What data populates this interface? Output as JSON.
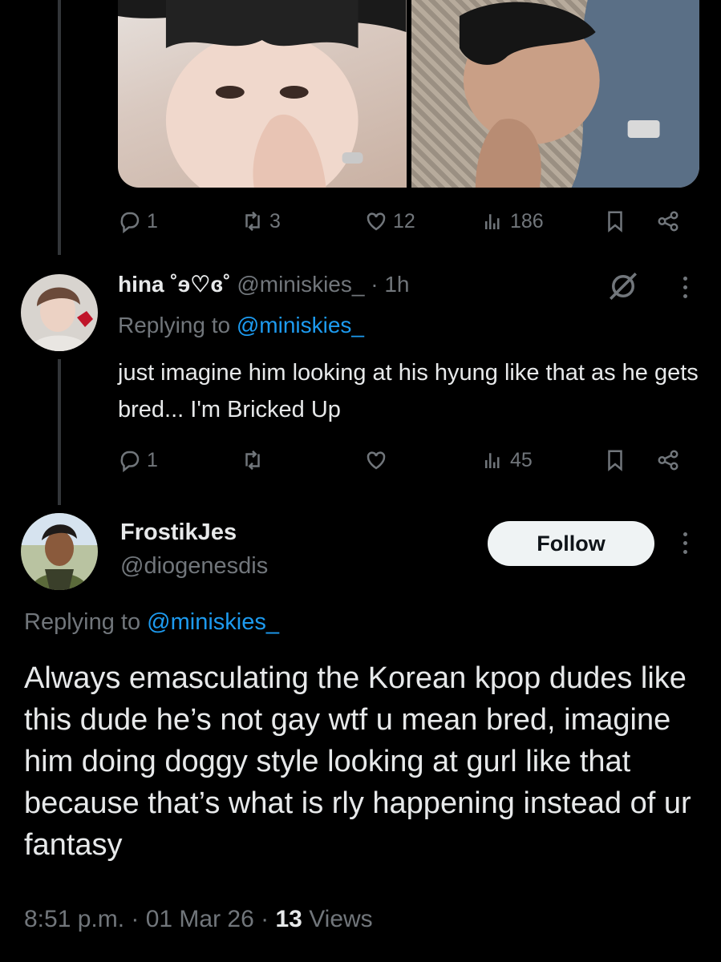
{
  "colors": {
    "background": "#000000",
    "text": "#e7e9ea",
    "muted": "#71767b",
    "link": "#1d9bf0",
    "follow_bg": "#eff3f4"
  },
  "parent_post": {
    "media": [
      "photo-1",
      "photo-2"
    ],
    "actions": {
      "replies": "1",
      "reposts": "3",
      "likes": "12",
      "views": "186"
    },
    "icons": [
      "reply-icon",
      "repost-icon",
      "like-icon",
      "views-icon",
      "bookmark-icon",
      "share-icon"
    ]
  },
  "reply": {
    "display_name": "hina ˚ɘ♡ɞ˚",
    "handle": "@miniskies_",
    "time": "· 1h",
    "replying_prefix": "Replying to",
    "replying_handle": "@miniskies_",
    "text": "just imagine him looking at his hyung like that as he gets bred... I'm Bricked Up",
    "actions": {
      "replies": "1",
      "reposts": "",
      "likes": "",
      "views": "45"
    }
  },
  "main_post": {
    "display_name": "FrostikJes",
    "handle": "@diogenesdis",
    "follow_label": "Follow",
    "replying_prefix": "Replying to",
    "replying_handle": "@miniskies_",
    "text": "Always emasculating the Korean kpop dudes like this dude he’s not gay wtf u mean bred, imagine him doing doggy style looking at gurl like that because that’s what is rly happening instead of ur fantasy",
    "time": "8:51 p.m. · 01 Mar 26 ·",
    "views_count": "13",
    "views_label": "Views"
  }
}
